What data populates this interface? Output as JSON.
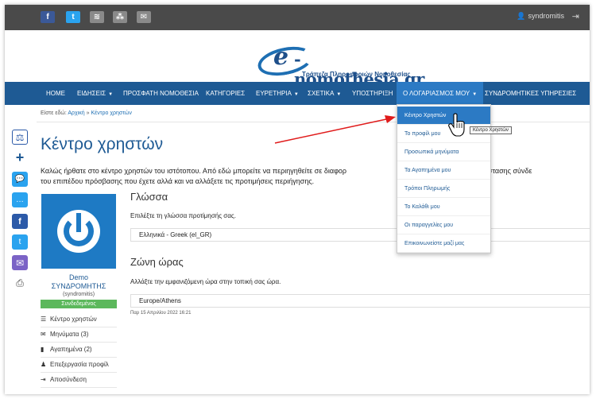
{
  "topbar": {
    "social": [
      {
        "icon": "facebook-icon",
        "glyph": "f"
      },
      {
        "icon": "twitter-icon",
        "glyph": "t"
      },
      {
        "icon": "rss-icon",
        "glyph": "≋"
      },
      {
        "icon": "sitemap-icon",
        "glyph": "⁂"
      },
      {
        "icon": "mail-icon",
        "glyph": "✉"
      }
    ],
    "username": "syndromitis"
  },
  "logo": {
    "name": "e-nomothesia.gr",
    "e": "e",
    "word": "-nomothesia.gr",
    "subtitle": "Τράπεζα Πληροφοριών Νομοθεσίας"
  },
  "nav": {
    "home": "HOME",
    "news": "ΕΙΔΗΣΕΙΣ",
    "recent": "ΠΡΟΣΦΑΤΗ ΝΟΜΟΘΕΣΙΑ",
    "categories": "ΚΑΤΗΓΟΡΙΕΣ",
    "indexes": "ΕΥΡΕΤΗΡΙΑ",
    "related": "ΣΧΕΤΙΚΑ",
    "support": "ΥΠΟΣΤΗΡΙΞΗ",
    "account": "Ο ΛΟΓΑΡΙΑΣΜΟΣ ΜΟΥ",
    "subscriptions": "ΣΥΝΔΡΟΜΗΤΙΚΕΣ ΥΠΗΡΕΣΙΕΣ"
  },
  "breadcrumb": {
    "prefix": "Είστε εδώ:",
    "home": "Αρχική",
    "sep": "»",
    "current": "Κέντρο χρηστών"
  },
  "page": {
    "title": "Κέντρο χρηστών",
    "intro": "Καλώς ήρθατε στο κέντρο χρηστών του ιστότοπου. Από εδώ μπορείτε να περιηγηθείτε σε διαφορ",
    "intro_tail": "γα της κατάστασης σύνδε",
    "intro2": "του επιπέδου πρόσβασης που έχετε αλλά και να αλλάξετε τις προτιμήσεις περιήγησης."
  },
  "profile": {
    "name1": "Demo",
    "name2": "ΣΥΝΔΡΟΜΗΤΗΣ",
    "username": "(syndromitis)",
    "status": "Συνδεδεμένος",
    "menu": [
      {
        "icon": "☰",
        "label": "Κέντρο χρηστών"
      },
      {
        "icon": "✉",
        "label": "Μηνύματα (3)"
      },
      {
        "icon": "▮",
        "label": "Αγαπημένα (2)"
      },
      {
        "icon": "♟",
        "label": "Επεξεργασία προφίλ"
      },
      {
        "icon": "⇥",
        "label": "Αποσύνδεση"
      }
    ]
  },
  "language": {
    "heading": "Γλώσσα",
    "desc": "Επιλέξτε τη γλώσσα προτίμησής σας.",
    "value": "Ελληνικά - Greek (el_GR)"
  },
  "timezone": {
    "heading": "Ζώνη ώρας",
    "desc": "Αλλάξτε την εμφανιζόμενη ώρα στην τοπική σας ώρα.",
    "value": "Europe/Athens",
    "date": "Παρ 15 Απριλίου 2022 16:21"
  },
  "dropdown": {
    "items": [
      "Κέντρο Χρηστών",
      "Το προφίλ μου",
      "Προσωπικά μηνύματα",
      "Τα Αγαπημένα μου",
      "Τρόποι Πληρωμής",
      "Το Καλάθι μου",
      "Οι παραγγελίες μου",
      "Επικοινωνείστε μαζί μας"
    ],
    "tooltip": "Κέντρο Χρηστών"
  },
  "colors": {
    "nav": "#1e5a94",
    "accent": "#2c7ac4",
    "status": "#5cb85c",
    "arrow": "#e01b1b"
  }
}
